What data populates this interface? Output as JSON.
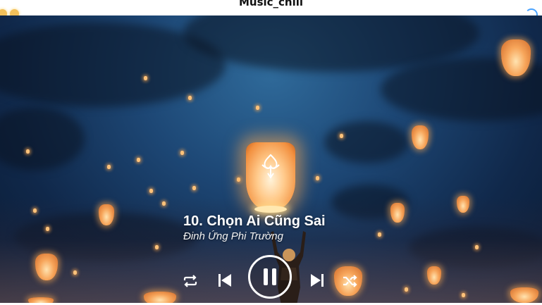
{
  "app": {
    "title": "Music_chill"
  },
  "now_playing": {
    "title": "10. Chọn Ai Cũng Sai",
    "artist": "Đinh Ứng Phi Trường",
    "state": "playing"
  },
  "controls": {
    "repeat_icon": "repeat-icon",
    "prev_icon": "skip-previous-icon",
    "pause_icon": "pause-icon",
    "next_icon": "skip-next-icon",
    "shuffle_icon": "shuffle-icon"
  },
  "colors": {
    "sky_top": "#1d4775",
    "sky_bottom": "#0a1a32",
    "lantern_glow": "#f7a55a",
    "control": "#ffffff"
  }
}
